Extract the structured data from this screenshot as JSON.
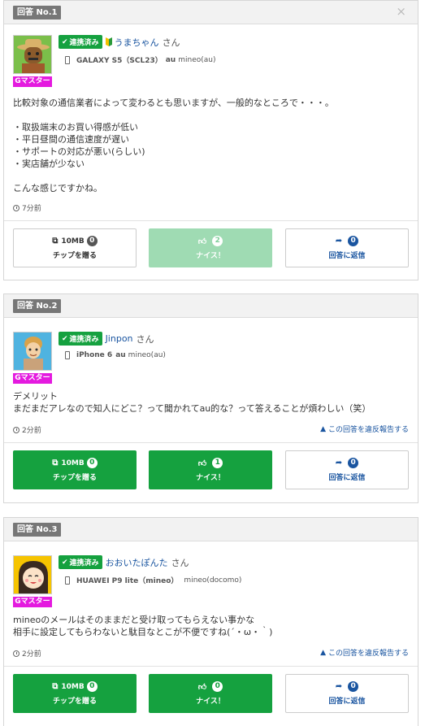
{
  "answers": [
    {
      "badge": "回答 No.1",
      "close": "×",
      "linked": "連携済み",
      "user": "うまちゃん",
      "san": "さん",
      "rank": "Gマスター",
      "model": "GALAXY S5（SCL23）",
      "carrier": "au",
      "plan": "mineo(au)",
      "message": "比較対象の通信業者によって変わるとも思いますが、一般的なところで・・・。\n\n・取扱端末のお買い得感が低い\n・平日昼間の通信速度が遅い\n・サポートの対応が悪い(らしい)\n・実店舗が少ない\n\nこんな感じですかね。",
      "time": "7分前",
      "tip_label": "10MB",
      "tip_count": "0",
      "tip_action": "チップを贈る",
      "nice_count": "2",
      "nice_label": "ナイス！",
      "reply_count": "0",
      "reply_label": "回答に返信"
    },
    {
      "badge": "回答 No.2",
      "linked": "連携済み",
      "user": "Jinpon",
      "san": "さん",
      "rank": "Gマスター",
      "model": "iPhone 6",
      "carrier": "au",
      "plan": "mineo(au)",
      "message": "デメリット\nまだまだアレなので知人にどこ？って聞かれてau的な？って答えることが煩わしい（笑）",
      "time": "2分前",
      "report": "この回答を違反報告する",
      "tip_label": "10MB",
      "tip_count": "0",
      "tip_action": "チップを贈る",
      "nice_count": "1",
      "nice_label": "ナイス！",
      "reply_count": "0",
      "reply_label": "回答に返信"
    },
    {
      "badge": "回答 No.3",
      "linked": "連携済み",
      "user": "おおいたぽんた",
      "san": "さん",
      "rank": "Gマスター",
      "model": "HUAWEI P9 lite（mineo）",
      "carrier": "",
      "plan": "mineo(docomo)",
      "message": "mineoのメールはそのままだと受け取ってもらえない事かな\n相手に設定してもらわないと駄目なとこが不便ですね(´・ω・｀)",
      "time": "2分前",
      "report": "この回答を違反報告する",
      "tip_label": "10MB",
      "tip_count": "0",
      "tip_action": "チップを贈る",
      "nice_count": "0",
      "nice_label": "ナイス！",
      "reply_count": "0",
      "reply_label": "回答に返信"
    }
  ],
  "colors": {
    "green": "#15a13f",
    "light_green": "#9fdbb3",
    "link": "#1a55a0",
    "rank": "#e41adf"
  }
}
